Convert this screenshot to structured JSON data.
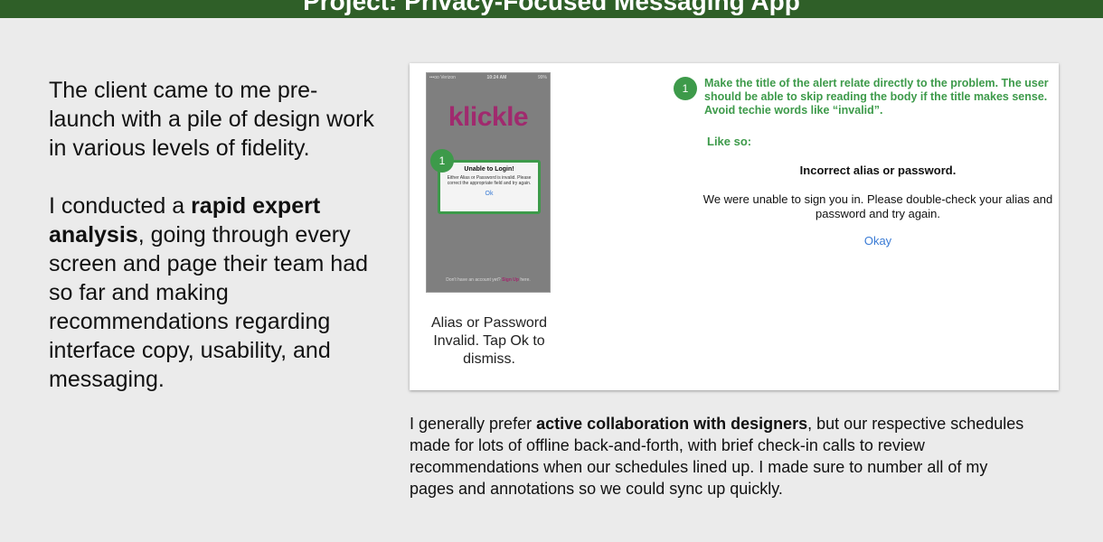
{
  "banner": {
    "title": "Project: Privacy-Focused Messaging App"
  },
  "intro": {
    "para1": "The client came to me pre-launch with a pile of design work in various levels of fidelity.",
    "para2_prefix": "I conducted a ",
    "para2_bold": "rapid expert analysis",
    "para2_suffix": ", going through every screen and page their team had so far and making recommendations regarding interface copy, usability, and messaging."
  },
  "phone": {
    "carrier": "•••oo Verizon",
    "time": "10:24 AM",
    "battery": "99%",
    "logo": "klickle",
    "badge": "1",
    "alert_title": "Unable to Login!",
    "alert_body": "Either Alias or Password is invalid. Please correct the appropriate field and try again.",
    "alert_ok": "Ok",
    "footer_prefix": "Don't have an account yet?",
    "footer_signup": "Sign Up",
    "footer_suffix": "here."
  },
  "caption": "Alias or Password Invalid. Tap Ok to dismiss.",
  "annotation": {
    "badge": "1",
    "text": "Make the title of the alert relate directly to the problem. The user should be able to skip reading the body if the title makes sense. Avoid techie words like “invalid”.",
    "like_so": "Like so:",
    "example_title": "Incorrect alias or password.",
    "example_body": "We were unable to sign you in. Please double-check your alias and password and try again.",
    "example_okay": "Okay"
  },
  "bottom": {
    "prefix": "I generally prefer ",
    "bold": "active collaboration with designers",
    "suffix": ", but our respective schedules made for lots of offline back-and-forth, with brief check-in calls to review recommendations when our schedules lined up. I made sure to number all of my pages and annotations so we could sync up quickly."
  },
  "colors": {
    "banner": "#2f5f28",
    "accent_green": "#3d9a4a",
    "brand_magenta": "#a02a6e",
    "link_blue": "#3a7bd5"
  }
}
